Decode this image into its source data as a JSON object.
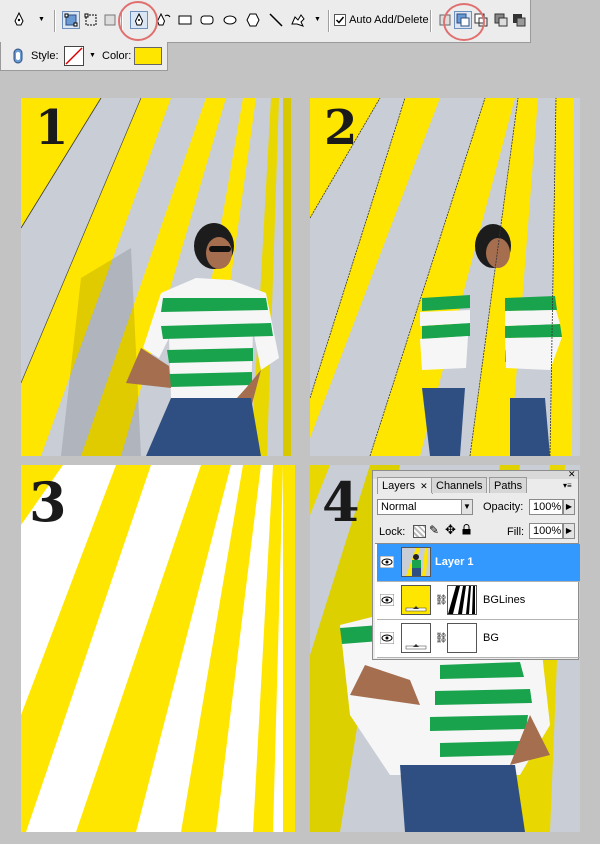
{
  "toolbar": {
    "auto_add_delete_label": "Auto Add/Delete",
    "auto_add_delete_checked": true,
    "style_label": "Style:",
    "color_label": "Color:",
    "color_value": "#ffe600"
  },
  "panels": [
    {
      "number": "1"
    },
    {
      "number": "2"
    },
    {
      "number": "3"
    },
    {
      "number": "4"
    }
  ],
  "layers_panel": {
    "tabs": [
      "Layers",
      "Channels",
      "Paths"
    ],
    "blend_mode": "Normal",
    "opacity_label": "Opacity:",
    "opacity_value": "100%",
    "lock_label": "Lock:",
    "fill_label": "Fill:",
    "fill_value": "100%",
    "layers": [
      {
        "name": "Layer 1",
        "selected": true
      },
      {
        "name": "BGLines",
        "selected": false
      },
      {
        "name": "BG",
        "selected": false
      }
    ]
  },
  "colors": {
    "accent_yellow": "#ffe600",
    "selection_blue": "#3399ff",
    "highlight_circle": "#e07070"
  }
}
